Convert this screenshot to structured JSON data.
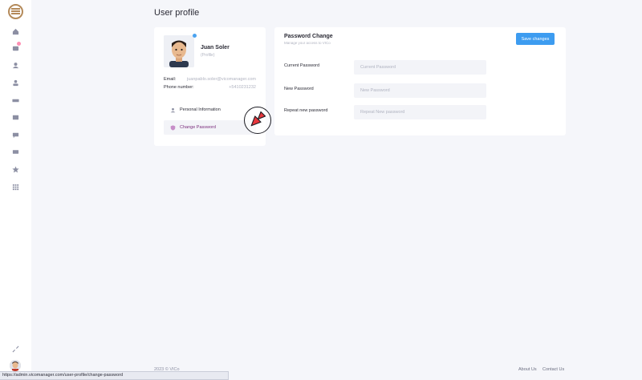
{
  "page": {
    "title": "User profile"
  },
  "sidebar": {
    "items": [
      {
        "name": "home-icon"
      },
      {
        "name": "messages-icon"
      },
      {
        "name": "user-icon"
      },
      {
        "name": "profile-icon"
      },
      {
        "name": "card-icon"
      },
      {
        "name": "list-icon"
      },
      {
        "name": "chat-icon"
      },
      {
        "name": "inbox-icon"
      },
      {
        "name": "star-icon"
      },
      {
        "name": "grid-icon"
      }
    ]
  },
  "profile": {
    "name": "Juan Soler",
    "role": "(Profile)",
    "email_label": "Email:",
    "email_value": "juanpablo.soler@vicomanager.com",
    "phone_label": "Phone number:",
    "phone_value": "+5410231232",
    "menu": [
      {
        "label": "Personal Information"
      },
      {
        "label": "Change Password"
      }
    ]
  },
  "password": {
    "title": "Password Change",
    "subtitle": "Manage your access to VICo",
    "save_label": "Save changes",
    "fields": [
      {
        "label": "Current Password",
        "placeholder": "Current Password"
      },
      {
        "label": "New Password",
        "placeholder": "New Password"
      },
      {
        "label": "Repeat new password",
        "placeholder": "Repeat New password"
      }
    ]
  },
  "footer": {
    "copyright": "2023 © VICo",
    "about": "About Us",
    "contact": "Contact Us"
  },
  "status_url": "https://admin.vicomanager.com/user-profile/change-password",
  "colors": {
    "accent": "#3d9cf0",
    "active_menu": "#7b2d7c",
    "brand": "#b48a5a"
  }
}
